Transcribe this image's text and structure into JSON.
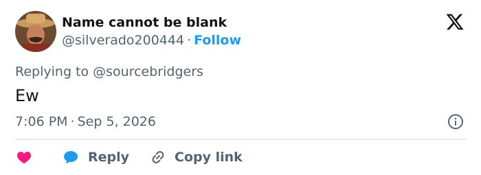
{
  "author": {
    "display_name": "Name cannot be blank",
    "handle": "@silverado200444",
    "separator": "·",
    "follow_label": "Follow"
  },
  "tweet": {
    "replying_to": "Replying to @sourcebridgers",
    "text": "Ew",
    "time": "7:06 PM",
    "date": "Sep 5, 2026"
  },
  "actions": {
    "like_icon": "heart-icon",
    "reply_label": "Reply",
    "copy_label": "Copy link"
  },
  "colors": {
    "accent": "#1d9bf0",
    "like": "#f91880",
    "secondary_text": "#536471",
    "primary_text": "#0f1419",
    "divider": "#cfd9de"
  }
}
